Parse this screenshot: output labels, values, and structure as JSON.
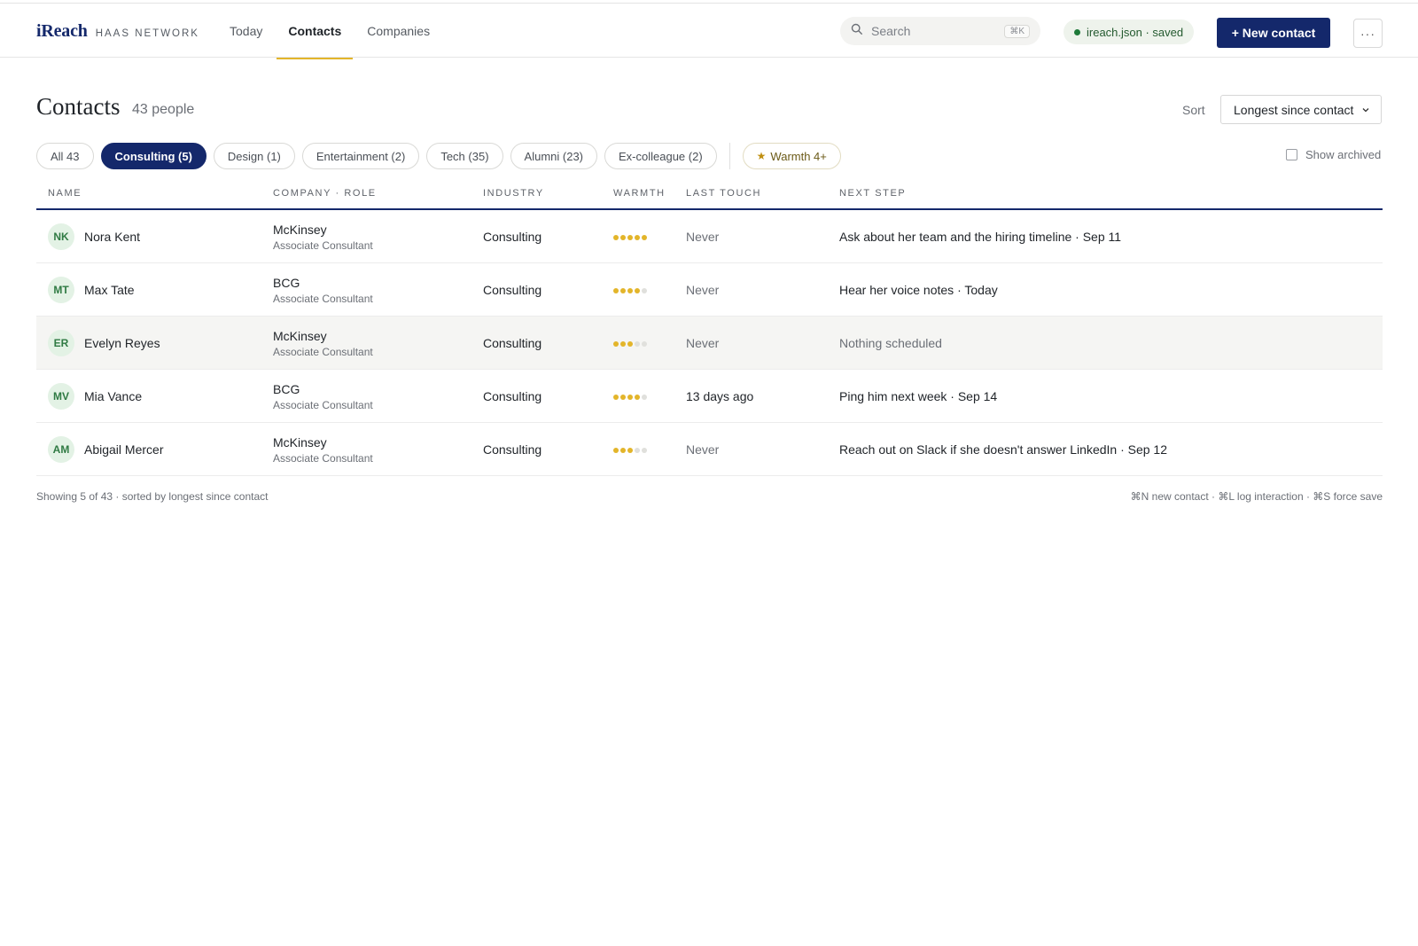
{
  "brand": {
    "logo": "iReach",
    "subtitle": "HAAS NETWORK"
  },
  "nav": {
    "tabs": [
      {
        "label": "Today"
      },
      {
        "label": "Contacts",
        "active": true
      },
      {
        "label": "Companies"
      }
    ]
  },
  "search": {
    "placeholder": "Search",
    "shortcut": "⌘K"
  },
  "save_status": {
    "label": "ireach.json · saved"
  },
  "actions": {
    "new_contact": "+ New contact",
    "more": "···"
  },
  "header": {
    "title": "Contacts",
    "count": "43 people"
  },
  "sort": {
    "label": "Sort",
    "value": "Longest since contact"
  },
  "filters": {
    "chips": [
      {
        "label": "All 43"
      },
      {
        "label": "Consulting (5)",
        "active": true
      },
      {
        "label": "Design (1)"
      },
      {
        "label": "Entertainment (2)"
      },
      {
        "label": "Tech (35)"
      },
      {
        "label": "Alumni (23)"
      },
      {
        "label": "Ex-colleague (2)"
      }
    ],
    "warmth_chip": {
      "icon": "star-icon",
      "label": "Warmth 4+"
    },
    "show_archived": "Show archived"
  },
  "table": {
    "columns": [
      "NAME",
      "COMPANY · ROLE",
      "INDUSTRY",
      "WARMTH",
      "LAST TOUCH",
      "NEXT STEP"
    ],
    "rows": [
      {
        "initials": "NK",
        "name": "Nora Kent",
        "company": "McKinsey",
        "role": "Associate Consultant",
        "industry": "Consulting",
        "warmth": 5,
        "last_touch": "Never",
        "next_step": "Ask about her team and the hiring timeline · Sep 11"
      },
      {
        "initials": "MT",
        "name": "Max Tate",
        "company": "BCG",
        "role": "Associate Consultant",
        "industry": "Consulting",
        "warmth": 4,
        "last_touch": "Never",
        "next_step": "Hear her voice notes · Today"
      },
      {
        "initials": "ER",
        "name": "Evelyn Reyes",
        "company": "McKinsey",
        "role": "Associate Consultant",
        "industry": "Consulting",
        "warmth": 3,
        "last_touch": "Never",
        "next_step": "Nothing scheduled",
        "highlighted": true
      },
      {
        "initials": "MV",
        "name": "Mia Vance",
        "company": "BCG",
        "role": "Associate Consultant",
        "industry": "Consulting",
        "warmth": 4,
        "last_touch": "13 days ago",
        "next_step": "Ping him next week · Sep 14"
      },
      {
        "initials": "AM",
        "name": "Abigail Mercer",
        "company": "McKinsey",
        "role": "Associate Consultant",
        "industry": "Consulting",
        "warmth": 3,
        "last_touch": "Never",
        "next_step": "Reach out on Slack if she doesn't answer LinkedIn · Sep 12"
      }
    ],
    "warmth_max": 5
  },
  "footer": {
    "status": "Showing 5 of 43 · sorted by longest since contact",
    "shortcuts": "⌘N new contact · ⌘L log interaction · ⌘S force save"
  },
  "colors": {
    "brand_navy": "#14286b",
    "accent_gold": "#e3b52a",
    "avatar_green": "#2f7a43",
    "saved_green": "#1f7a3a"
  }
}
